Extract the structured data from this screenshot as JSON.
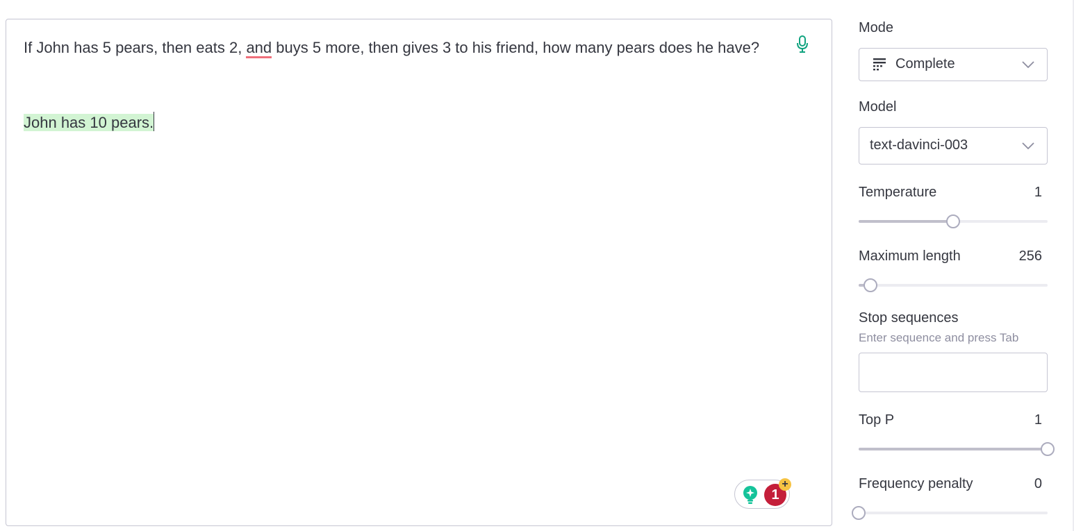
{
  "editor": {
    "prompt_before": "If John has 5 pears, then eats 2, ",
    "prompt_underlined": "and",
    "prompt_after": " buys 5 more, then gives 3 to his friend, how many pears does he have?",
    "completion": "John has 10 pears.",
    "mic_icon": "microphone-icon",
    "grammarly": {
      "count": "1",
      "plus": "+"
    }
  },
  "sidebar": {
    "mode": {
      "label": "Mode",
      "value": "Complete",
      "icon": "complete-mode-icon"
    },
    "model": {
      "label": "Model",
      "value": "text-davinci-003"
    },
    "temperature": {
      "label": "Temperature",
      "value": "1",
      "fraction": 0.5
    },
    "max_length": {
      "label": "Maximum length",
      "value": "256",
      "fraction": 0.062
    },
    "stop_sequences": {
      "label": "Stop sequences",
      "hint": "Enter sequence and press Tab",
      "value": ""
    },
    "top_p": {
      "label": "Top P",
      "value": "1",
      "fraction": 1.0
    },
    "frequency_penalty": {
      "label": "Frequency penalty",
      "value": "0",
      "fraction": 0.0
    }
  },
  "colors": {
    "completion_highlight": "#d2f4d3",
    "accent": "#10a37f",
    "error": "#c41e3a"
  }
}
